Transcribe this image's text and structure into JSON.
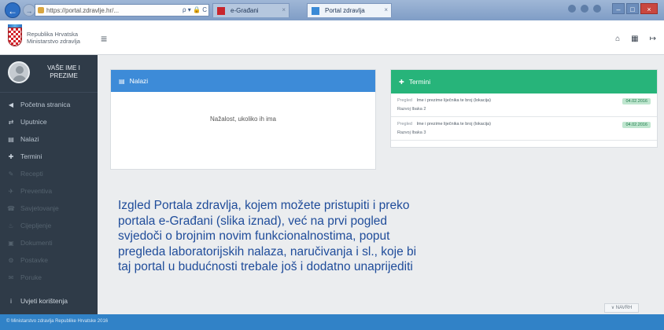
{
  "browser": {
    "back_glyph": "←",
    "forward_glyph": "→",
    "address": "https://portal.zdravlje.hr/...",
    "address_tools": "ρ ▾ 🔒 C",
    "tabs": [
      {
        "label": "e-Građani",
        "close": "×"
      },
      {
        "label": "Portal zdravlja",
        "close": "×"
      }
    ],
    "window_controls": {
      "minimize": "–",
      "maximize": "□",
      "close": "×"
    }
  },
  "header": {
    "logo_lines": [
      "Republika Hrvatska",
      "Ministarstvo zdravlja"
    ],
    "menu_glyph": "≡",
    "icons": {
      "home": "⌂",
      "grid": "▦",
      "exit": "↦"
    }
  },
  "sidebar": {
    "user_name": "VAŠE IME I PREZIME",
    "items": [
      {
        "icon": "◀",
        "label": "Početna stranica",
        "faded": false
      },
      {
        "icon": "⇄",
        "label": "Uputnice",
        "faded": false
      },
      {
        "icon": "▤",
        "label": "Nalazi",
        "faded": false
      },
      {
        "icon": "✚",
        "label": "Termini",
        "faded": false
      },
      {
        "icon": "✎",
        "label": "Recepti",
        "faded": true
      },
      {
        "icon": "✈",
        "label": "Preventiva",
        "faded": true
      },
      {
        "icon": "☎",
        "label": "Savjetovanje",
        "faded": true
      },
      {
        "icon": "♨",
        "label": "Cijepljenje",
        "faded": true
      },
      {
        "icon": "▣",
        "label": "Dokumenti",
        "faded": true
      },
      {
        "icon": "⚙",
        "label": "Postavke",
        "faded": true
      },
      {
        "icon": "✉",
        "label": "Poruke",
        "faded": true
      }
    ],
    "bottom_item": {
      "icon": "i",
      "label": "Uvjeti korištenja"
    }
  },
  "nalazi": {
    "icon": "▤",
    "title": "Nalazi",
    "empty_text": "Nažalost, ukoliko ih ima"
  },
  "termini": {
    "icon": "✚",
    "title": "Termini",
    "rows": [
      {
        "label": "Pregled",
        "text": "Ime i prezime liječnika te broj (lokacija)",
        "sub": "Razvoj Ibaka 2",
        "date": "04.02.2016"
      },
      {
        "label": "Pregled",
        "text": "Ime i prezime liječnika te broj (lokacija)",
        "sub": "Razvoj Ibaka 3",
        "date": "04.02.2016"
      }
    ]
  },
  "caption": {
    "lines": [
      "Izgled Portala zdravlja, kojem možete pristupiti i preko",
      "portala e-Građani (slika iznad), već na prvi pogled",
      "svjedoči o brojnim novim funkcionalnostima, poput",
      "pregleda laboratorijskih nalaza, naručivanja i sl., koje bi",
      "taj portal u budućnosti trebale još i dodatno unaprijediti"
    ]
  },
  "footer": {
    "text": "© Ministarstvo zdravlja Republike Hrvatske 2016",
    "scroll_up": "∨ NAVRH"
  },
  "colors": {
    "sidebar": "#2f3b48",
    "nalazi_header": "#3d8bd8",
    "termini_header": "#27b47a",
    "footer": "#3182c7",
    "caption": "#1f4c9a"
  }
}
